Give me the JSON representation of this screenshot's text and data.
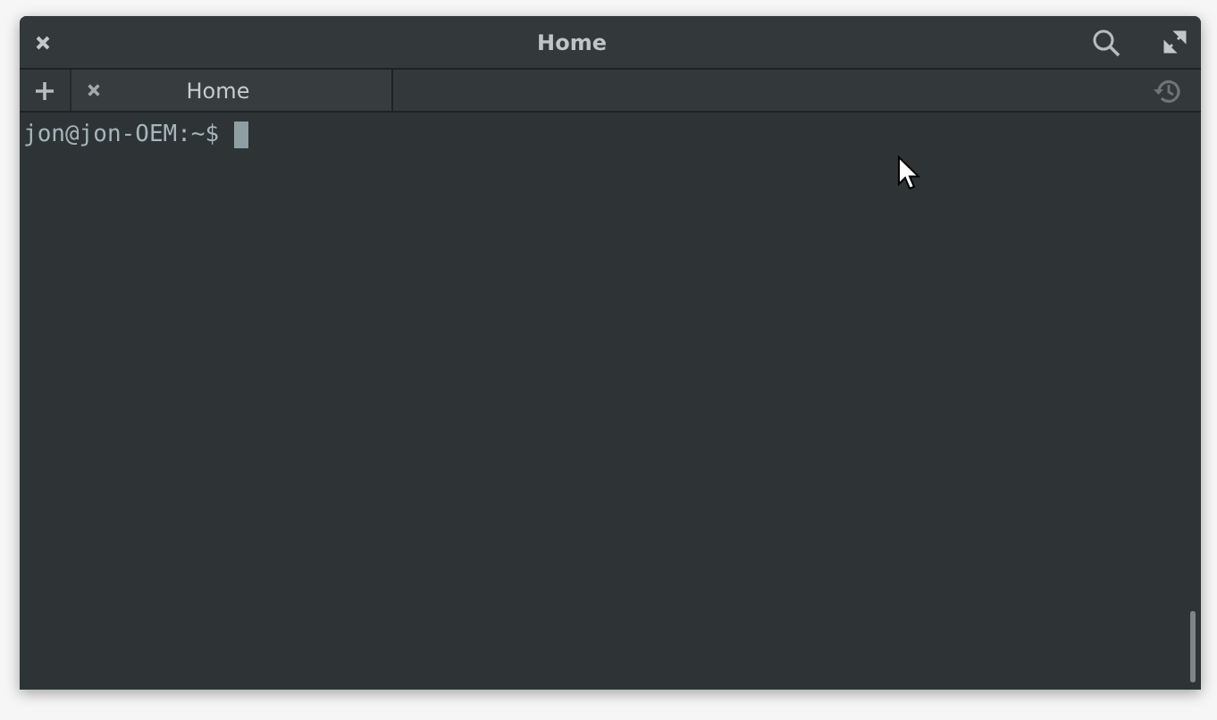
{
  "window": {
    "title": "Home"
  },
  "tabs": [
    {
      "label": "Home",
      "selected": true
    }
  ],
  "terminal": {
    "prompt": "jon@jon-OEM:~$"
  }
}
